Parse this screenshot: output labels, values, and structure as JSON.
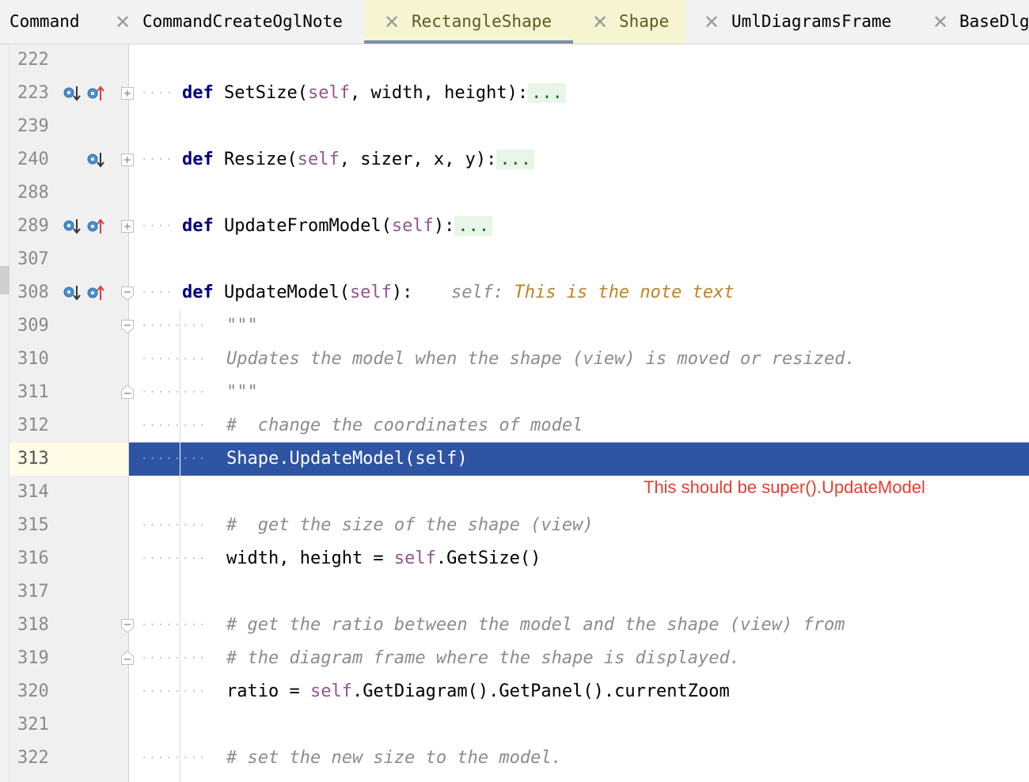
{
  "tabs": [
    {
      "label": "Command",
      "close": false
    },
    {
      "label": "CommandCreateOglNote",
      "close": true
    },
    {
      "label": "RectangleShape",
      "close": true,
      "active": true
    },
    {
      "label": "Shape",
      "close": true
    },
    {
      "label": "UmlDiagramsFrame",
      "close": true
    },
    {
      "label": "BaseDlg",
      "close": true
    }
  ],
  "close_glyph": "✕",
  "editor": {
    "fold_placeholder": "...",
    "inlay_hint": {
      "label": "self:",
      "value": "This is the note text"
    },
    "annotation": "This should be super().UpdateModel",
    "lines": [
      {
        "n": "222",
        "tokens": []
      },
      {
        "n": "223",
        "tokens": [
          {
            "t": "def",
            "c": "kw"
          },
          {
            "t": " SetSize("
          },
          {
            "t": "self",
            "c": "slf"
          },
          {
            "t": ", width, height):"
          }
        ]
      },
      {
        "n": "239",
        "tokens": []
      },
      {
        "n": "240",
        "tokens": [
          {
            "t": "def",
            "c": "kw"
          },
          {
            "t": " Resize("
          },
          {
            "t": "self",
            "c": "slf"
          },
          {
            "t": ", sizer, x, y):"
          }
        ]
      },
      {
        "n": "288",
        "tokens": []
      },
      {
        "n": "289",
        "tokens": [
          {
            "t": "def",
            "c": "kw"
          },
          {
            "t": " UpdateFromModel("
          },
          {
            "t": "self",
            "c": "slf"
          },
          {
            "t": "):"
          }
        ]
      },
      {
        "n": "307",
        "tokens": []
      },
      {
        "n": "308",
        "tokens": [
          {
            "t": "def",
            "c": "kw"
          },
          {
            "t": " UpdateModel("
          },
          {
            "t": "self",
            "c": "slf"
          },
          {
            "t": "):"
          }
        ]
      },
      {
        "n": "309",
        "tokens": [
          {
            "t": "\"\"\"",
            "c": "cmt"
          }
        ]
      },
      {
        "n": "310",
        "tokens": [
          {
            "t": "Updates the model when the shape (view) is moved or resized.",
            "c": "cmt"
          }
        ]
      },
      {
        "n": "311",
        "tokens": [
          {
            "t": "\"\"\"",
            "c": "cmt"
          }
        ]
      },
      {
        "n": "312",
        "tokens": [
          {
            "t": "#  change the coordinates of model",
            "c": "cmt"
          }
        ]
      },
      {
        "n": "313",
        "tokens": [
          {
            "t": "Shape.UpdateModel(self)"
          }
        ]
      },
      {
        "n": "314",
        "tokens": []
      },
      {
        "n": "315",
        "tokens": [
          {
            "t": "#  get the size of the shape (view)",
            "c": "cmt"
          }
        ]
      },
      {
        "n": "316",
        "tokens": [
          {
            "t": "width, height = "
          },
          {
            "t": "self",
            "c": "slf"
          },
          {
            "t": ".GetSize()"
          }
        ]
      },
      {
        "n": "317",
        "tokens": []
      },
      {
        "n": "318",
        "tokens": [
          {
            "t": "# get the ratio between the model and the shape (view) from",
            "c": "cmt"
          }
        ]
      },
      {
        "n": "319",
        "tokens": [
          {
            "t": "# the diagram frame where the shape is displayed.",
            "c": "cmt"
          }
        ]
      },
      {
        "n": "320",
        "tokens": [
          {
            "t": "ratio = "
          },
          {
            "t": "self",
            "c": "slf"
          },
          {
            "t": ".GetDiagram().GetPanel().currentZoom"
          }
        ]
      },
      {
        "n": "321",
        "tokens": []
      },
      {
        "n": "322",
        "tokens": [
          {
            "t": "# set the new size to the model.",
            "c": "cmt"
          }
        ]
      }
    ]
  },
  "colors": {
    "keyword": "#00007f",
    "self": "#94558d",
    "comment": "#8c8c8c",
    "hint_value": "#c0822b",
    "selection": "#2f54a3",
    "annotation": "#e53e32"
  }
}
